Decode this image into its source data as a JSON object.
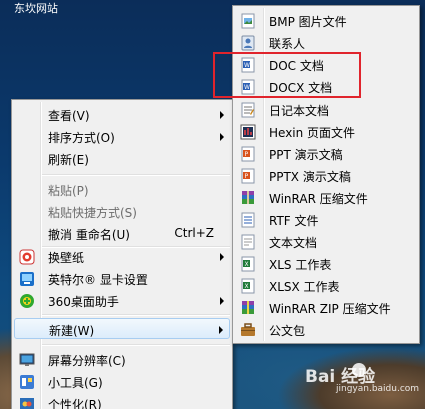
{
  "desktop": {
    "corner_label": "东坎网站"
  },
  "context_menu": {
    "items": [
      {
        "label": "查看(V)",
        "arrow": true
      },
      {
        "label": "排序方式(O)",
        "arrow": true
      },
      {
        "label": "刷新(E)"
      },
      {
        "label": "粘贴(P)",
        "disabled": true
      },
      {
        "label": "粘贴快捷方式(S)",
        "disabled": true
      },
      {
        "label": "撤消 重命名(U)",
        "shortcut": "Ctrl+Z"
      },
      {
        "label": "换壁纸",
        "icon": "wallpaper-icon",
        "arrow": true
      },
      {
        "label": "英特尔® 显卡设置",
        "icon": "intel-graphics-icon"
      },
      {
        "label": "360桌面助手",
        "icon": "360-icon",
        "arrow": true
      },
      {
        "label": "新建(W)",
        "arrow": true,
        "highlighted": true
      },
      {
        "label": "屏幕分辨率(C)",
        "icon": "display-icon"
      },
      {
        "label": "小工具(G)",
        "icon": "gadgets-icon"
      },
      {
        "label": "个性化(R)",
        "icon": "personalize-icon"
      }
    ]
  },
  "new_submenu": {
    "items": [
      {
        "label": "BMP 图片文件",
        "icon": "bmp-file-icon"
      },
      {
        "label": "联系人",
        "icon": "contact-icon"
      },
      {
        "label": "DOC 文档",
        "icon": "doc-file-icon",
        "highlighted": true
      },
      {
        "label": "DOCX 文档",
        "icon": "docx-file-icon"
      },
      {
        "label": "日记本文档",
        "icon": "journal-file-icon"
      },
      {
        "label": "Hexin 页面文件",
        "icon": "hexin-file-icon"
      },
      {
        "label": "PPT 演示文稿",
        "icon": "ppt-file-icon"
      },
      {
        "label": "PPTX 演示文稿",
        "icon": "pptx-file-icon"
      },
      {
        "label": "WinRAR 压缩文件",
        "icon": "winrar-file-icon"
      },
      {
        "label": "RTF 文件",
        "icon": "rtf-file-icon"
      },
      {
        "label": "文本文档",
        "icon": "text-file-icon"
      },
      {
        "label": "XLS 工作表",
        "icon": "xls-file-icon"
      },
      {
        "label": "XLSX 工作表",
        "icon": "xlsx-file-icon"
      },
      {
        "label": "WinRAR ZIP 压缩文件",
        "icon": "winrar-zip-file-icon"
      },
      {
        "label": "公文包",
        "icon": "briefcase-icon"
      }
    ]
  },
  "annotation": {
    "color": "#e0242c"
  },
  "watermark": {
    "text": "Bai 经验",
    "sub": "jingyan.baidu.com"
  }
}
